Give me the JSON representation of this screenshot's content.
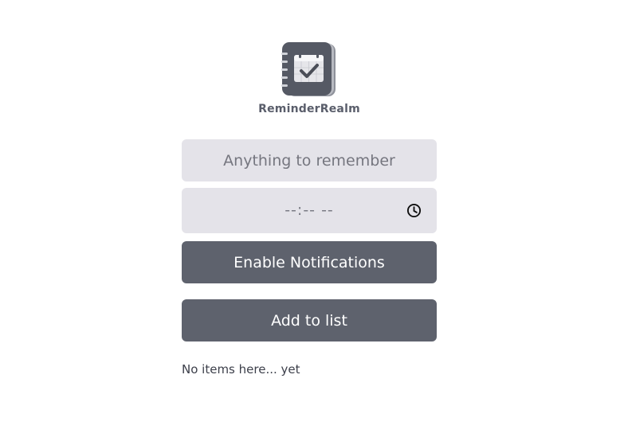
{
  "app": {
    "name": "ReminderRealm",
    "logo_icon": "notebook-checkmark-icon"
  },
  "form": {
    "reminder_placeholder": "Anything to remember",
    "reminder_value": "",
    "time_value": "--:-- --",
    "time_icon": "clock-icon"
  },
  "actions": {
    "enable_notifications_label": "Enable Notifications",
    "add_label": "Add to list"
  },
  "list": {
    "empty_message": "No items here... yet"
  },
  "colors": {
    "button_bg": "#5e626d",
    "field_bg": "#e4e3e9",
    "text": "#3c3f4a"
  }
}
